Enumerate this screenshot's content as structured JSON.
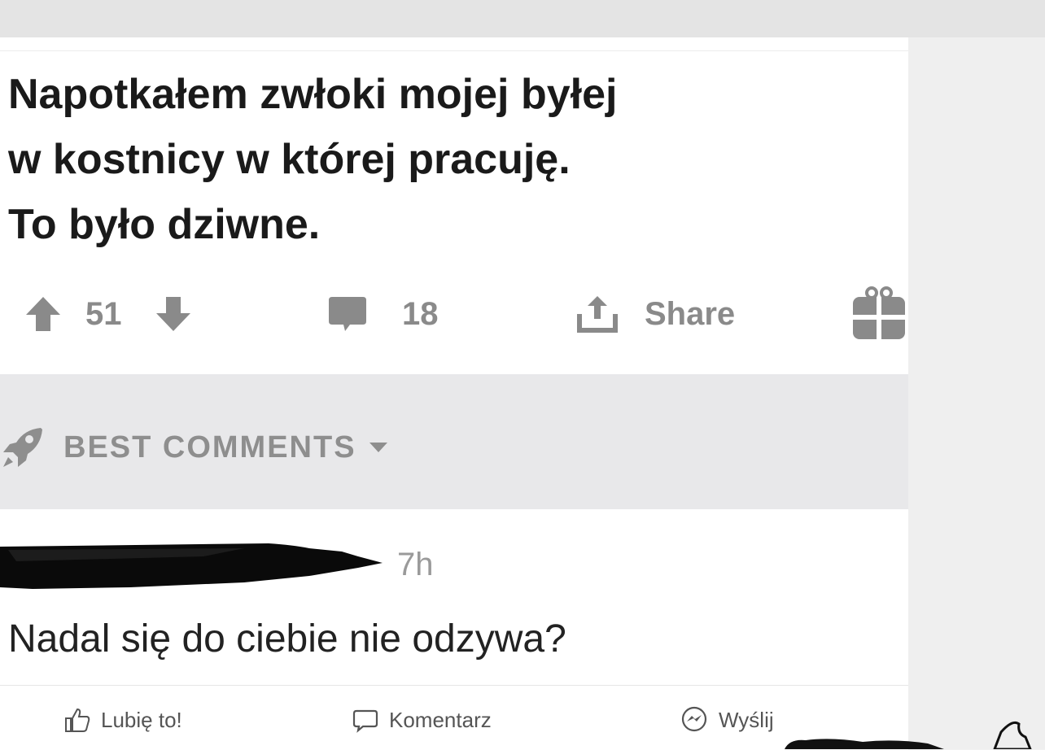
{
  "post": {
    "title_lines": [
      "Napotkałem zwłoki mojej byłej",
      "w kostnicy w której pracuję.",
      "To było dziwne."
    ],
    "votes": "51",
    "comments_count": "18",
    "share_label": "Share"
  },
  "sort": {
    "label": "BEST COMMENTS"
  },
  "comment": {
    "time": "7h",
    "text": "Nadal się do ciebie nie odzywa?"
  },
  "facebook_bar": {
    "like_label": "Lubię to!",
    "comment_label": "Komentarz",
    "send_label": "Wyślij"
  },
  "icons": {
    "upvote": "arrow-up-icon",
    "downvote": "arrow-down-icon",
    "comments": "speech-bubble-icon",
    "share": "share-upload-icon",
    "award": "gift-icon",
    "sort": "rocket-icon",
    "caret": "caret-down-icon"
  },
  "colors": {
    "icon_gray": "#8a8a8a",
    "sort_bg": "#e8e8ea",
    "title": "#1a1a1a"
  }
}
